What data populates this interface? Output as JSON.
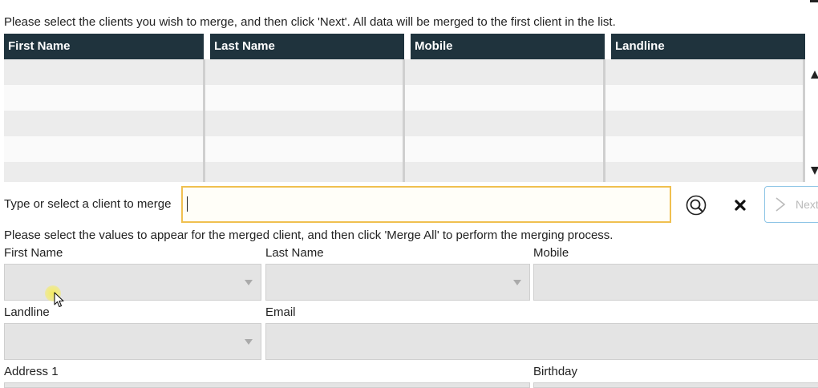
{
  "intro_text": "Please select the clients you wish to merge, and then click 'Next'. All data will be merged to the first client in the list.",
  "grid": {
    "columns": [
      "First Name",
      "Last Name",
      "Mobile",
      "Landline"
    ],
    "rows": []
  },
  "search": {
    "label": "Type or select a client to merge",
    "value": "",
    "search_icon": "magnifier-icon",
    "clear_icon": "close-icon",
    "next_label": "Next"
  },
  "merge_instructions": "Please select the values to appear for the merged client, and then click 'Merge All' to perform the merging process.",
  "fields": {
    "first_name": "First Name",
    "last_name": "Last Name",
    "mobile": "Mobile",
    "landline": "Landline",
    "email": "Email",
    "address1": "Address 1",
    "birthday": "Birthday"
  },
  "colors": {
    "header_bg": "#1f333d",
    "input_border": "#f0c050",
    "next_border": "#8ec5e6"
  }
}
